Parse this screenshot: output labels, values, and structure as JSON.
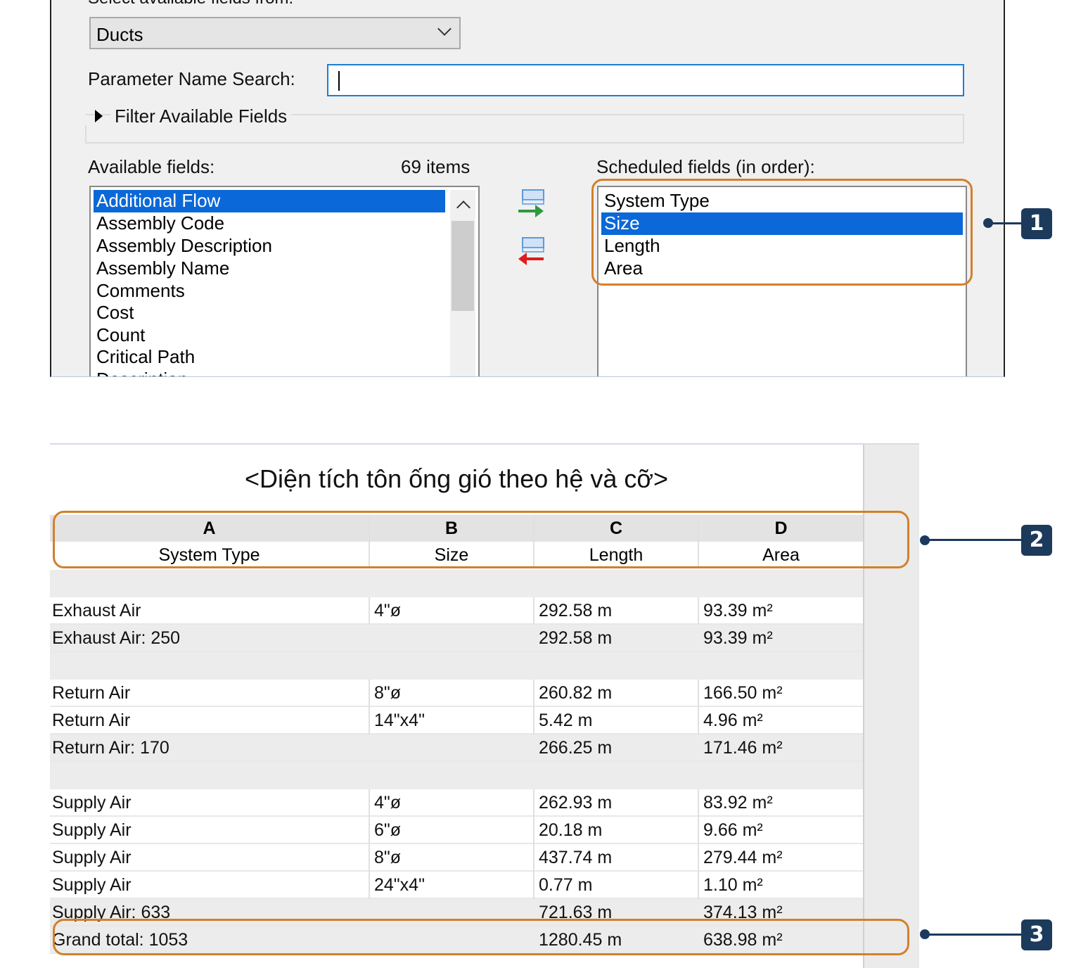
{
  "dialog": {
    "select_fields_from_label": "Select available fields from:",
    "category_value": "Ducts",
    "search_label": "Parameter Name Search:",
    "search_value": "",
    "filter_label": "Filter Available Fields",
    "available_label": "Available fields:",
    "available_count": "69 items",
    "scheduled_label": "Scheduled fields (in order):",
    "available_fields": [
      "Additional Flow",
      "Assembly Code",
      "Assembly Description",
      "Assembly Name",
      "Comments",
      "Cost",
      "Count",
      "Critical Path",
      "Description"
    ],
    "available_selected": "Additional Flow",
    "scheduled_fields": [
      "System Type",
      "Size",
      "Length",
      "Area"
    ],
    "scheduled_selected": "Size",
    "add_icon": "add-parameter-arrow-right",
    "remove_icon": "remove-parameter-arrow-left"
  },
  "schedule": {
    "title": "<Diện tích tôn ống gió theo hệ và cỡ>",
    "column_letters": [
      "A",
      "B",
      "C",
      "D"
    ],
    "column_names": [
      "System Type",
      "Size",
      "Length",
      "Area"
    ],
    "rows": [
      {
        "kind": "gap",
        "cells": [
          "",
          "",
          "",
          ""
        ]
      },
      {
        "kind": "data",
        "cells": [
          "Exhaust Air",
          "4\"ø",
          "292.58 m",
          "93.39 m²"
        ]
      },
      {
        "kind": "total",
        "cells": [
          "Exhaust Air: 250",
          "",
          "292.58 m",
          "93.39 m²"
        ]
      },
      {
        "kind": "gap",
        "cells": [
          "",
          "",
          "",
          ""
        ]
      },
      {
        "kind": "data",
        "cells": [
          "Return Air",
          "8\"ø",
          "260.82 m",
          "166.50 m²"
        ]
      },
      {
        "kind": "data",
        "cells": [
          "Return Air",
          "14\"x4\"",
          "5.42 m",
          "4.96 m²"
        ]
      },
      {
        "kind": "total",
        "cells": [
          "Return Air: 170",
          "",
          "266.25 m",
          "171.46 m²"
        ]
      },
      {
        "kind": "gap",
        "cells": [
          "",
          "",
          "",
          ""
        ]
      },
      {
        "kind": "data",
        "cells": [
          "Supply Air",
          "4\"ø",
          "262.93 m",
          "83.92 m²"
        ]
      },
      {
        "kind": "data",
        "cells": [
          "Supply Air",
          "6\"ø",
          "20.18 m",
          "9.66 m²"
        ]
      },
      {
        "kind": "data",
        "cells": [
          "Supply Air",
          "8\"ø",
          "437.74 m",
          "279.44 m²"
        ]
      },
      {
        "kind": "data",
        "cells": [
          "Supply Air",
          "24\"x4\"",
          "0.77 m",
          "1.10 m²"
        ]
      },
      {
        "kind": "total",
        "cells": [
          "Supply Air: 633",
          "",
          "721.63 m",
          "374.13 m²"
        ]
      },
      {
        "kind": "total",
        "cells": [
          "Grand total: 1053",
          "",
          "1280.45 m",
          "638.98 m²"
        ]
      }
    ]
  },
  "callouts": [
    "1",
    "2",
    "3"
  ],
  "colors": {
    "highlight": "#d2802a",
    "badge": "#1c3a5c",
    "selection": "#0a68d8",
    "search_focus": "#1a7fd4"
  }
}
